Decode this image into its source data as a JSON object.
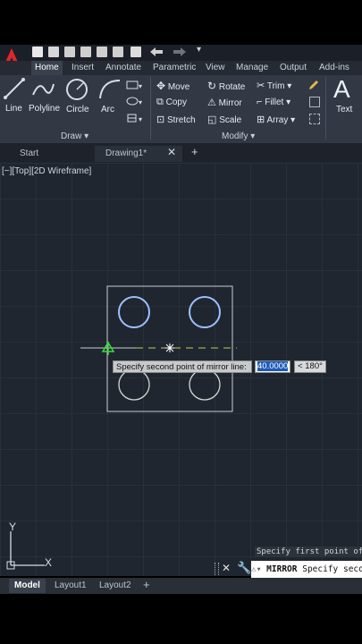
{
  "ribbon_tabs": [
    "Home",
    "Insert",
    "Annotate",
    "Parametric",
    "View",
    "Manage",
    "Output",
    "Add-ins"
  ],
  "draw_group": {
    "title": "Draw",
    "tools": [
      "Line",
      "Polyline",
      "Circle",
      "Arc"
    ]
  },
  "modify_group": {
    "title": "Modify",
    "tools": [
      "Move",
      "Rotate",
      "Trim",
      "Copy",
      "Mirror",
      "Fillet",
      "Stretch",
      "Scale",
      "Array"
    ]
  },
  "annotation_group": {
    "text_tool": "Text"
  },
  "document_tabs": [
    {
      "label": "Start"
    },
    {
      "label": "Drawing1*"
    }
  ],
  "viewport_label": "[−][Top][2D Wireframe]",
  "dynamic_prompt": {
    "text": "Specify second point of mirror line:",
    "value": "40.0000",
    "angle": "< 180°"
  },
  "command": {
    "history": "Specify first point of",
    "name": "MIRROR",
    "prompt": "Specify second"
  },
  "ucs": {
    "x": "X",
    "y": "Y"
  },
  "layout_tabs": [
    "Model",
    "Layout1",
    "Layout2"
  ],
  "colors": {
    "app_red": "#e0262b",
    "ribbon_bg": "#323945",
    "canvas_bg": "#1f262f",
    "circle_selected": "#8fb4ff",
    "mirror_line": "#c8c94a"
  }
}
